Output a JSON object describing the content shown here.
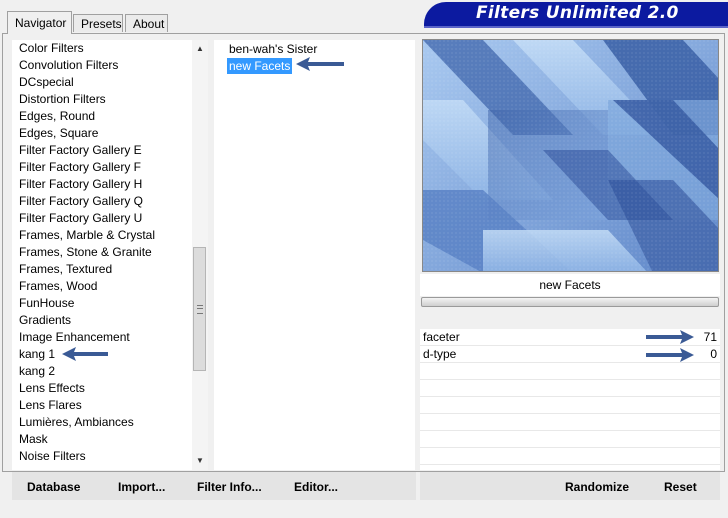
{
  "tabs": [
    {
      "label": "Navigator",
      "active": true
    },
    {
      "label": "Presets",
      "active": false
    },
    {
      "label": "About",
      "active": false
    }
  ],
  "banner": {
    "title": "Filters Unlimited 2.0"
  },
  "categories": [
    "Color Filters",
    "Convolution Filters",
    "DCspecial",
    "Distortion Filters",
    "Edges, Round",
    "Edges, Square",
    "Filter Factory Gallery E",
    "Filter Factory Gallery F",
    "Filter Factory Gallery H",
    "Filter Factory Gallery Q",
    "Filter Factory Gallery U",
    "Frames, Marble & Crystal",
    "Frames, Stone & Granite",
    "Frames, Textured",
    "Frames, Wood",
    "FunHouse",
    "Gradients",
    "Image Enhancement",
    "kang 1",
    "kang 2",
    "Lens Effects",
    "Lens Flares",
    "Lumières, Ambiances",
    "Mask",
    "Noise Filters"
  ],
  "selected_category": "kang 1",
  "filters": [
    "ben-wah's Sister",
    "new Facets"
  ],
  "selected_filter": "new Facets",
  "preview": {
    "filter_name": "new Facets"
  },
  "parameters": [
    {
      "name": "faceter",
      "value": "71"
    },
    {
      "name": "d-type",
      "value": "0"
    }
  ],
  "buttons": {
    "database": "Database",
    "import": "Import...",
    "filter_info": "Filter Info...",
    "editor": "Editor...",
    "randomize": "Randomize",
    "reset": "Reset"
  },
  "colors": {
    "accent": "#3399ff",
    "banner": "#0c1aa0",
    "arrow": "#3a5a95"
  }
}
